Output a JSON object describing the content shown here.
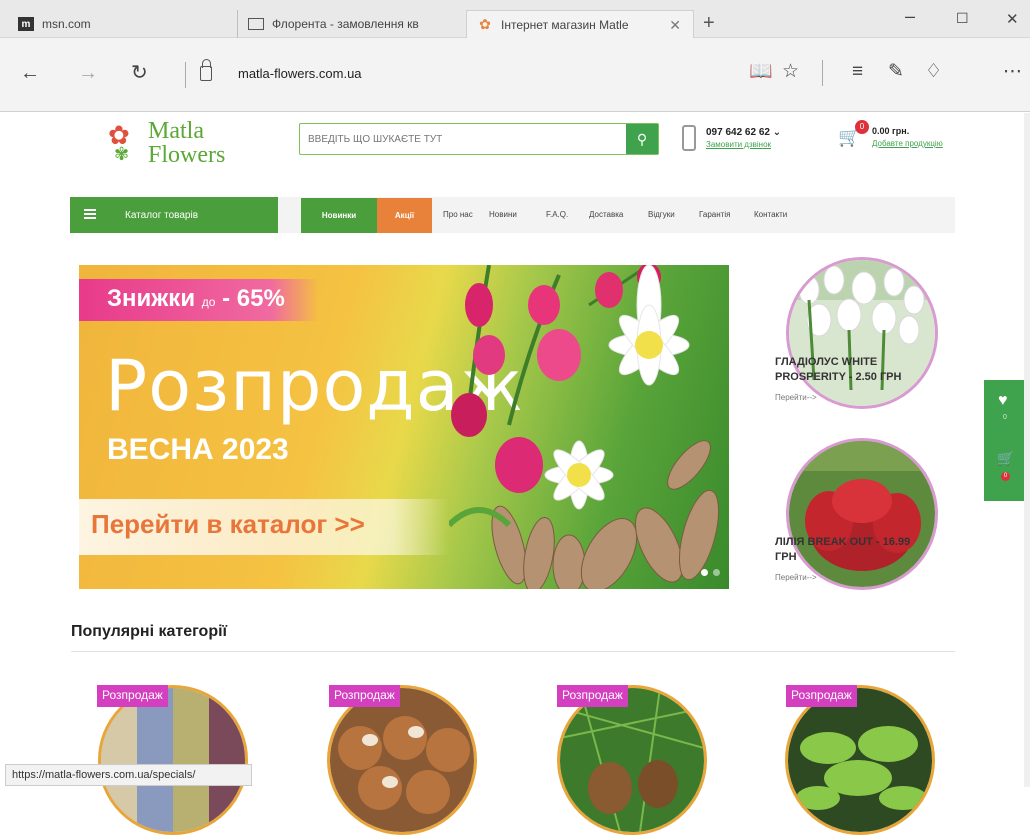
{
  "browser": {
    "tabs": [
      {
        "label": "msn.com"
      },
      {
        "label": "Флорента - замовлення кв"
      },
      {
        "label": "Інтернет магазин Matlе"
      }
    ],
    "new_tab": "+",
    "address": "matla-flowers.com.ua",
    "status_url": "https://matla-flowers.com.ua/specials/"
  },
  "site": {
    "logo": {
      "line1": "Matla",
      "line2": "Flowers"
    },
    "search": {
      "placeholder": "ВВЕДІТЬ ЩО ШУКАЄТЕ ТУТ"
    },
    "phone": {
      "number": "097 642 62 62 ⌄",
      "callback": "Замовити дзвінок"
    },
    "cart": {
      "count": "0",
      "total": "0.00 грн.",
      "link": "Добавте продукцію"
    },
    "menu": {
      "catalog": "Каталог товарів",
      "new": "Новинки",
      "sale": "Акції",
      "links": [
        "Про нас",
        "Новини",
        "F.A.Q.",
        "Доставка",
        "Відгуки",
        "Гарантія",
        "Контакти"
      ]
    },
    "banner": {
      "discount": "Знижки",
      "discount_small": "до",
      "discount_value": " - 65%",
      "title": "Розпродаж",
      "season": "ВЕСНА 2023",
      "cta": "Перейти в каталог >>"
    },
    "side_products": [
      {
        "title_l1": "ГЛАДІОЛУС WHITE",
        "title_l2": "PROSPERITY - 2.50 ГРН",
        "link": "Перейти-->"
      },
      {
        "title_l1": "ЛІЛІЯ BREAK OUT - 16.99",
        "title_l2": "ГРН",
        "link": "Перейти-->"
      }
    ],
    "float_panel": {
      "wish_count": "0",
      "cart_count": "0"
    },
    "popular_title": "Популярні категорії",
    "categories": [
      {
        "badge": "Розпродаж"
      },
      {
        "badge": "Розпродаж"
      },
      {
        "badge": "Розпродаж"
      },
      {
        "badge": "Розпродаж"
      }
    ]
  },
  "colors": {
    "brand_green": "#4a9e3b",
    "sale_orange": "#e8823a",
    "badge_pink": "#d43fbf"
  }
}
